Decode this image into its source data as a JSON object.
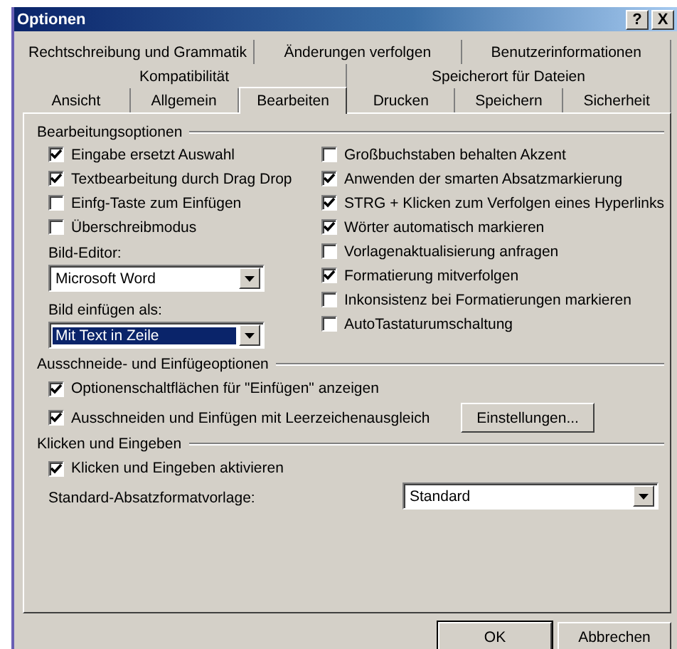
{
  "window": {
    "title": "Optionen",
    "title_buttons": [
      "?",
      "X"
    ]
  },
  "tab_rows": [
    [
      {
        "label": "Rechtschreibung und Grammatik",
        "selected": false
      },
      {
        "label": "Änderungen verfolgen",
        "selected": false
      },
      {
        "label": "Benutzerinformationen",
        "selected": false
      }
    ],
    [
      {
        "label": "Kompatibilität",
        "selected": false
      },
      {
        "label": "Speicherort für Dateien",
        "selected": false
      }
    ],
    [
      {
        "label": "Ansicht",
        "selected": false
      },
      {
        "label": "Allgemein",
        "selected": false
      },
      {
        "label": "Bearbeiten",
        "selected": true
      },
      {
        "label": "Drucken",
        "selected": false
      },
      {
        "label": "Speichern",
        "selected": false
      },
      {
        "label": "Sicherheit",
        "selected": false
      }
    ]
  ],
  "editing": {
    "title": "Bearbeitungsoptionen",
    "left": [
      {
        "kind": "checkbox",
        "label": "Eingabe ersetzt Auswahl",
        "checked": true
      },
      {
        "kind": "checkbox",
        "label": "Textbearbeitung durch Drag  Drop",
        "checked": true
      },
      {
        "kind": "checkbox",
        "label": "Einfg-Taste zum Einfügen",
        "checked": false
      },
      {
        "kind": "checkbox",
        "label": "Überschreibmodus",
        "checked": false
      },
      {
        "kind": "combo",
        "label": "Bild-Editor:",
        "value": "Microsoft Word",
        "focused": false
      },
      {
        "kind": "combo",
        "label": "Bild einfügen als:",
        "value": "Mit Text in Zeile",
        "focused": true
      }
    ],
    "right": [
      {
        "kind": "checkbox",
        "label": "Großbuchstaben behalten Akzent",
        "checked": false
      },
      {
        "kind": "checkbox",
        "label": "Anwenden der smarten Absatzmarkierung",
        "checked": true
      },
      {
        "kind": "checkbox",
        "label": "STRG + Klicken zum Verfolgen eines Hyperlinks",
        "checked": true
      },
      {
        "kind": "checkbox",
        "label": "Wörter automatisch markieren",
        "checked": true
      },
      {
        "kind": "checkbox",
        "label": "Vorlagenaktualisierung anfragen",
        "checked": false
      },
      {
        "kind": "checkbox",
        "label": "Formatierung mitverfolgen",
        "checked": true
      },
      {
        "kind": "checkbox",
        "label": "Inkonsistenz bei Formatierungen markieren",
        "checked": false
      },
      {
        "kind": "checkbox",
        "label": "AutoTastaturumschaltung",
        "checked": false
      }
    ]
  },
  "cut_paste": {
    "title": "Ausschneide- und Einfügeoptionen",
    "items": [
      {
        "kind": "checkbox",
        "label": "Optionenschaltflächen für \"Einfügen\" anzeigen",
        "checked": true
      },
      {
        "kind": "checkbox",
        "label": "Ausschneiden und Einfügen mit Leerzeichenausgleich",
        "checked": true,
        "button": "Einstellungen..."
      }
    ]
  },
  "click_type": {
    "title": "Klicken und Eingeben",
    "items": [
      {
        "kind": "checkbox",
        "label": "Klicken und Eingeben aktivieren",
        "checked": true
      },
      {
        "kind": "combo_row",
        "label": "Standard-Absatzformatvorlage:",
        "value": "Standard",
        "focused": false
      }
    ]
  },
  "buttons": [
    "OK",
    "Abbrechen"
  ]
}
